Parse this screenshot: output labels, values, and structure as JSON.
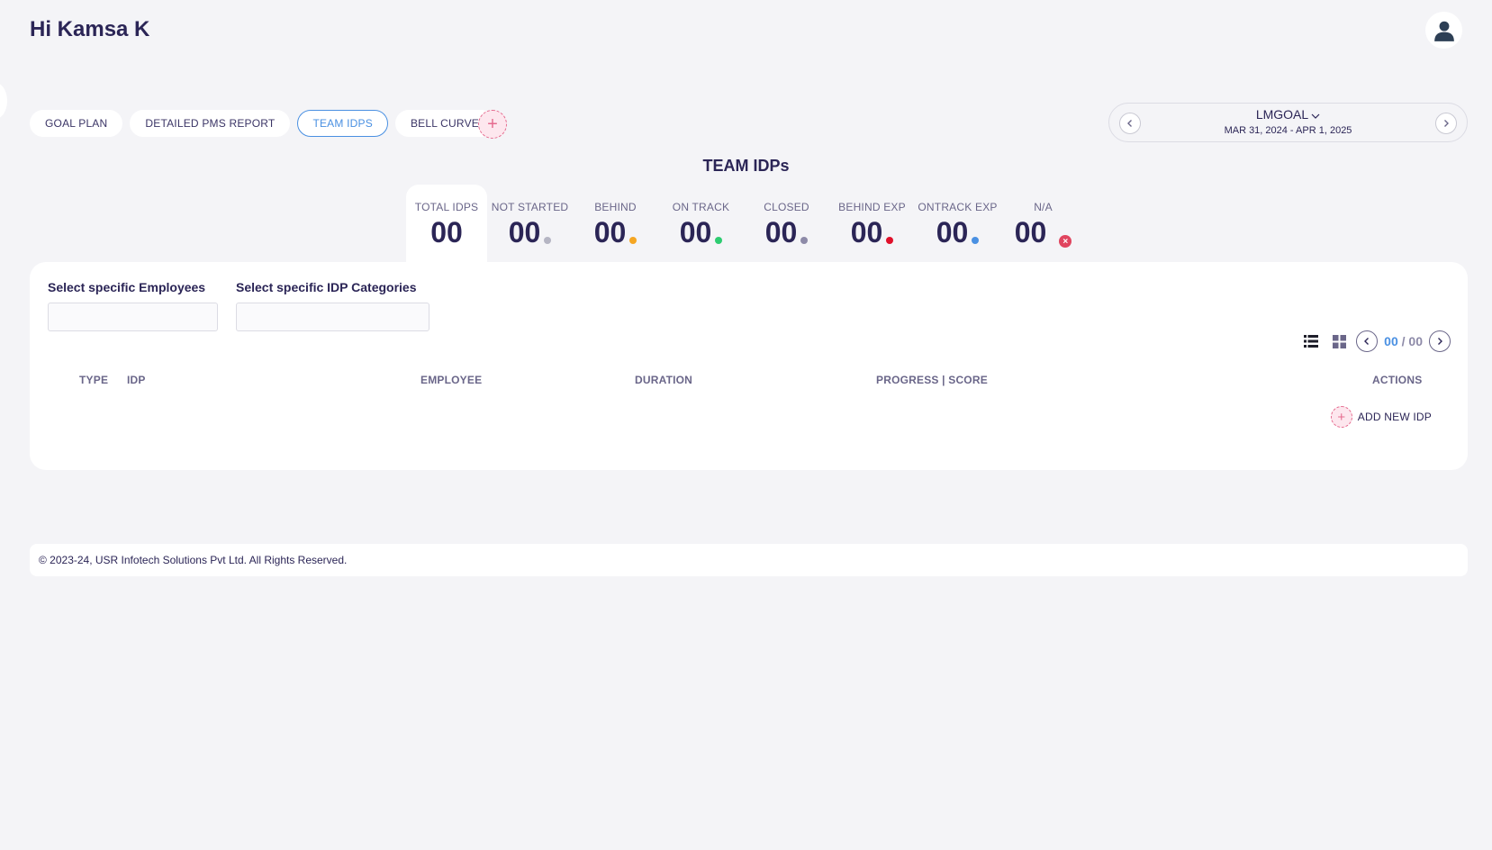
{
  "header": {
    "greeting": "Hi Kamsa K"
  },
  "tabs": [
    {
      "label": "GOAL PLAN",
      "active": false
    },
    {
      "label": "DETAILED PMS REPORT",
      "active": false
    },
    {
      "label": "TEAM IDPS",
      "active": true
    },
    {
      "label": "BELL CURVE",
      "active": false
    }
  ],
  "period": {
    "goal_name": "LMGOAL",
    "date_range": "MAR 31, 2024 - APR 1, 2025"
  },
  "section_title": "TEAM IDPs",
  "stats": [
    {
      "label": "TOTAL IDPS",
      "value": "00",
      "color": null
    },
    {
      "label": "NOT STARTED",
      "value": "00",
      "color": "#b5b5c3"
    },
    {
      "label": "BEHIND",
      "value": "00",
      "color": "#f5a623"
    },
    {
      "label": "ON TRACK",
      "value": "00",
      "color": "#2ecc71"
    },
    {
      "label": "CLOSED",
      "value": "00",
      "color": "#8d8aa8"
    },
    {
      "label": "BEHIND EXP",
      "value": "00",
      "color": "#e0102a"
    },
    {
      "label": "ONTRACK EXP",
      "value": "00",
      "color": "#4a90e2"
    },
    {
      "label": "N/A",
      "value": "00",
      "color": "#e0455f"
    }
  ],
  "filters": {
    "employees_label": "Select specific Employees",
    "categories_label": "Select specific IDP Categories"
  },
  "pagination": {
    "current": "00",
    "separator": "/",
    "total": "00"
  },
  "table": {
    "columns": [
      "TYPE",
      "IDP",
      "EMPLOYEE",
      "DURATION",
      "PROGRESS | SCORE",
      "ACTIONS"
    ]
  },
  "add_idp_label": "ADD NEW IDP",
  "footer": {
    "copyright": "© 2023-24, USR Infotech Solutions Pvt Ltd. All Rights Reserved."
  },
  "colors": {
    "accent": "#4a90e2",
    "brand_pink": "#e56b8f",
    "text_dark": "#2b2556"
  },
  "icons": [
    "user-icon",
    "plus-icon",
    "chevron-left-icon",
    "chevron-right-icon",
    "chevron-down-icon",
    "list-view-icon",
    "grid-view-icon",
    "close-circle-icon"
  ]
}
